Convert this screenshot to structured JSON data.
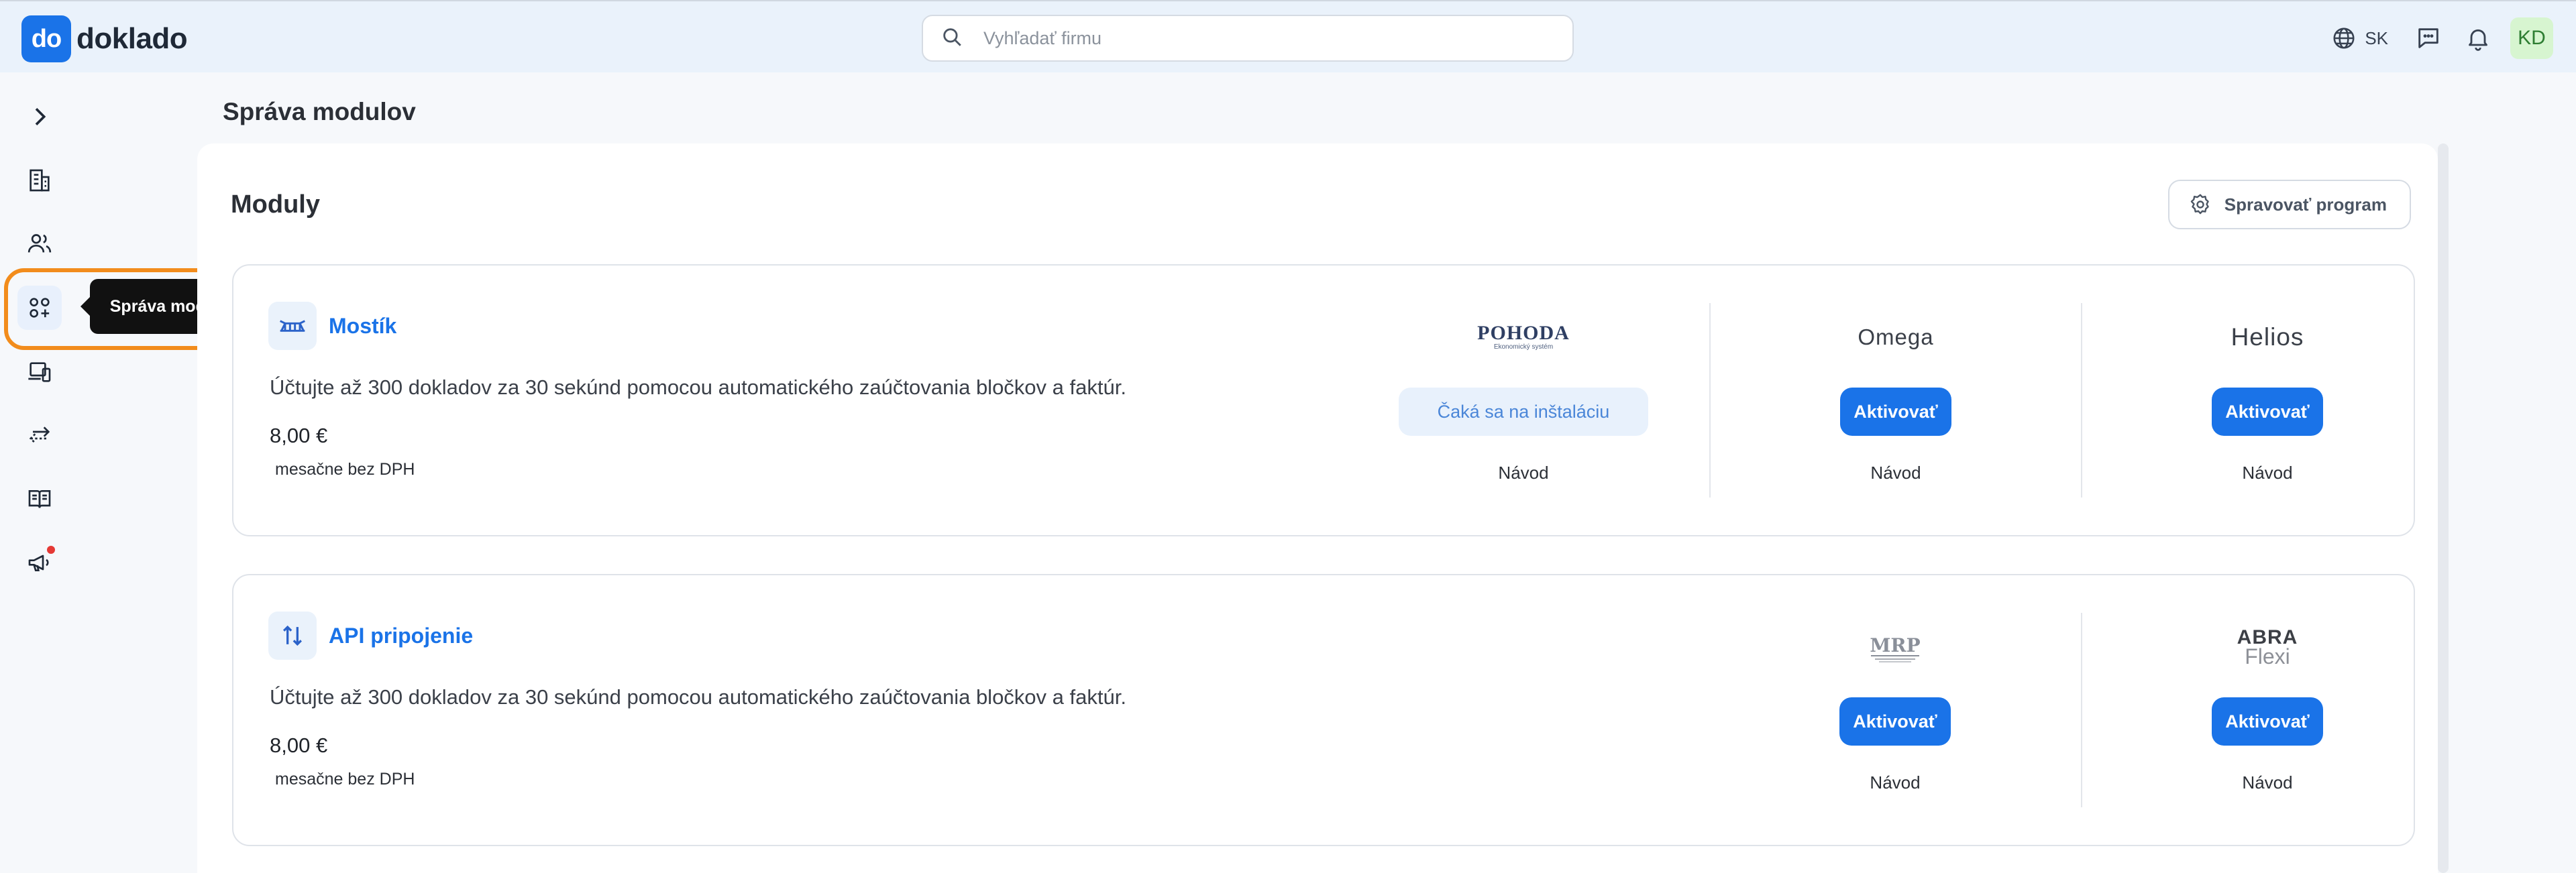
{
  "app": {
    "logo_badge": "do",
    "logo_text": "doklado"
  },
  "search": {
    "placeholder": "Vyhľadať firmu"
  },
  "header": {
    "language": "SK",
    "avatar_initials": "KD"
  },
  "sidebar": {
    "tooltip": "Správa modulov",
    "items": [
      {
        "icon": "chevron-right-icon"
      },
      {
        "icon": "building-icon"
      },
      {
        "icon": "users-icon"
      },
      {
        "icon": "modules-icon",
        "active": true
      },
      {
        "icon": "devices-icon"
      },
      {
        "icon": "transfer-icon"
      },
      {
        "icon": "book-icon"
      },
      {
        "icon": "megaphone-icon",
        "badge": true
      }
    ]
  },
  "page": {
    "title": "Správa modulov",
    "panel_title": "Moduly",
    "manage_button": "Spravovať program"
  },
  "modules": [
    {
      "name": "Mostík",
      "description": "Účtujte až 300 dokladov za 30 sekúnd pomocou automatického zaúčtovania bločkov a faktúr.",
      "price": "8,00 €",
      "period": "mesačne bez DPH",
      "integrations": [
        {
          "logo": "POHODA",
          "logo_sub": "Ekonomický systém",
          "button": "Čaká sa na inštaláciu",
          "state": "pending",
          "link": "Návod"
        },
        {
          "logo": "Omega",
          "button": "Aktivovať",
          "state": "available",
          "link": "Návod"
        },
        {
          "logo": "Helios",
          "button": "Aktivovať",
          "state": "available",
          "link": "Návod"
        }
      ]
    },
    {
      "name": "API pripojenie",
      "description": "Účtujte až 300 dokladov za 30 sekúnd pomocou automatického zaúčtovania bločkov a faktúr.",
      "price": "8,00 €",
      "period": "mesačne bez DPH",
      "integrations": [
        {
          "logo": "MRP",
          "button": "Aktivovať",
          "state": "available",
          "link": "Návod"
        },
        {
          "logo": "ABRA",
          "logo_sub": "Flexi",
          "button": "Aktivovať",
          "state": "available",
          "link": "Návod"
        }
      ]
    }
  ],
  "colors": {
    "accent": "#1a73e8",
    "header_bg": "#eaf2fb",
    "highlight": "#f28c1c",
    "pending_bg": "#e8f1fc"
  }
}
